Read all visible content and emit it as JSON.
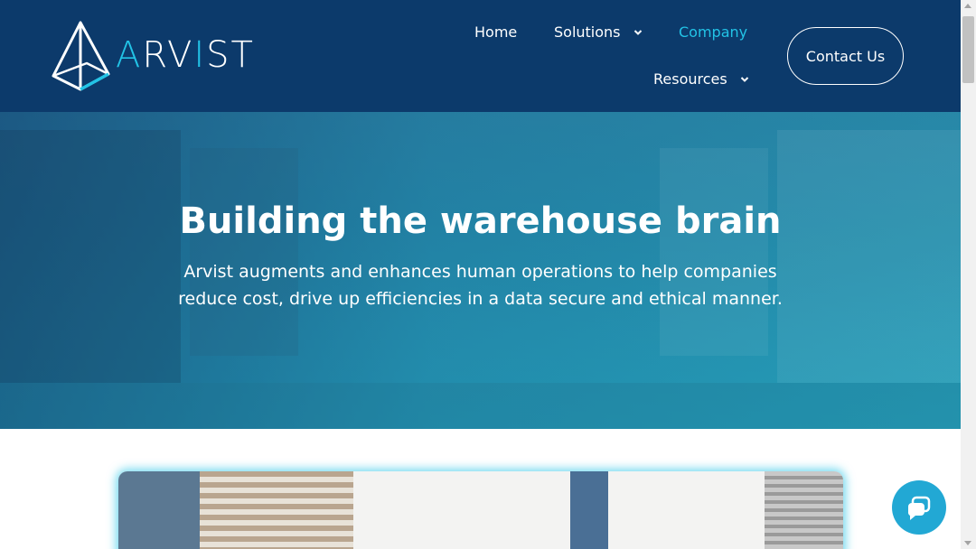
{
  "brand": {
    "name_part1": "A",
    "name_part2": "RV",
    "name_part3": "I",
    "name_part4": "ST",
    "accent_color": "#22c3e6",
    "header_color": "#0c3a6b"
  },
  "nav": {
    "home": "Home",
    "solutions": "Solutions",
    "company": "Company",
    "resources": "Resources",
    "contact": "Contact Us"
  },
  "hero": {
    "title": "Building the warehouse brain",
    "subtitle": "Arvist augments and enhances human operations to help companies reduce cost, drive up efficiencies in a data secure and ethical manner."
  },
  "icons": {
    "logo": "arvist-prism-logo",
    "chevron": "chevron-down-icon",
    "chat": "chat-bubble-icon"
  }
}
